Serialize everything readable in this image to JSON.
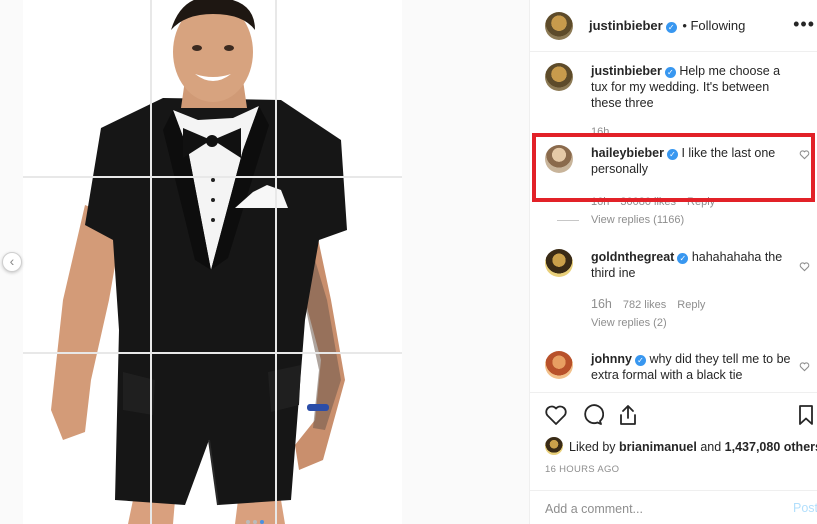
{
  "post": {
    "author": "justinbieber",
    "follow_status": "• Following",
    "more_label": "•••"
  },
  "comments": [
    {
      "username": "justinbieber",
      "text": "Help me choose a tux for my wedding. It's between these three",
      "time": "16h"
    },
    {
      "username": "haileybieber",
      "text": "I like the last one personally",
      "time": "16h",
      "likes": "30080 likes",
      "reply": "Reply",
      "view_replies": "View replies (1166)"
    },
    {
      "username": "goldnthegreat",
      "text": "hahahahaha the third ine",
      "time": "16h",
      "likes": "782 likes",
      "reply": "Reply",
      "view_replies": "View replies (2)"
    },
    {
      "username": "johnny",
      "text": "why did they tell me to be extra formal with a black tie",
      "time": "",
      "likes": "",
      "reply": ""
    }
  ],
  "footer": {
    "liked_by_prefix": "Liked by",
    "liked_by_user": "brianimanuel",
    "liked_by_suffix": "and",
    "likes_count": "1,437,080 others",
    "time_ago": "16 HOURS AGO",
    "add_comment_placeholder": "Add a comment...",
    "post_label": "Post"
  },
  "carousel": {
    "slide_count": 3,
    "active_slide": 3
  },
  "colors": {
    "highlight": "#e22128",
    "verified": "#3897f0",
    "post_disabled": "#b2dffc"
  }
}
